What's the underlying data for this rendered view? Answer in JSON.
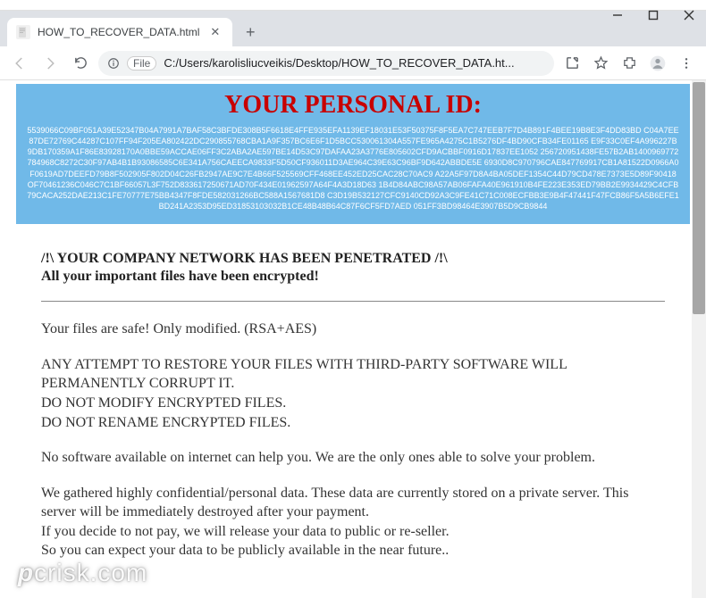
{
  "window": {
    "tab_title": "HOW_TO_RECOVER_DATA.html",
    "file_label": "File",
    "url": "C:/Users/karolisliucveikis/Desktop/HOW_TO_RECOVER_DATA.ht..."
  },
  "ransom": {
    "id_heading": "YOUR PERSONAL ID:",
    "id_l1": "5539066C09BF051A39E52347B04A7991A7BAF58C3BFDE308B5F6618E4FFE935EFA1139EF18031E53F50375F8F5EA7C747EEB7F7D4B891F4BEE19B8E3F4DD83BD",
    "id_l2": "C04A7EE87DE72769C44287C107FF94F205EA802422DC290855768CBA1A9F357BC6E6F1D5BCC530061304A557FE965A4275C1B5276DF4BD90CFB34FE01165",
    "id_l3": "E9F33C0EF4A996227B9DB170359A1F86E83928170A0BBE59ACCAE06FF3C2ABA2AE597BE14D53C97DAFAA23A3776E805602CFD9ACBBF0916D17837EE1052",
    "id_l4": "256720951438FE57B2AB1400969772784968C8272C30F97AB4B1B93086585C6E341A756CAEECA9833F5D50CF936011D3AE964C39E63C96BF9D642ABBDE5E",
    "id_l5": "6930D8C970796CAE847769917CB1A81522D0966A0F0619AD7DEEFD79B8F502905F802D04C26FB2947AE9C7E4B66F525569CFF468EE452ED25CAC28C70AC9",
    "id_l6": "A22A5F97D8A4BA05DEF1354C44D79CD478E7373E5D89F90418OF70461236C046C7C1BF66057L3F752D833617250671AD70F434E01962597A64F4A3D18D63",
    "id_l7": "1B4D84ABC98A57AB06FAFA40E961910B4FE223E353ED79BB2E9934429C4CFB79CACA252DAE213C1FE70777E75BB4347F8FDE582031266BC588A1567681D8",
    "id_l8": "C3D19B532127CFC9140CD92A3C9FE41C71C008ECFBB3E9B4F47441F47FCB86F5A5B6EFE1BD241A2353D95ED31853103032B1CE48B48B64C87F6CF5FD7AED",
    "id_l9": "051FF3BD98464E3907B5D9CB9844",
    "headline": "/!\\ YOUR COMPANY NETWORK HAS BEEN PENETRATED /!\\",
    "subhead": "All your important files have been encrypted!",
    "p_safe": "Your files are safe! Only modified. (RSA+AES)",
    "p_warn1": "ANY ATTEMPT TO RESTORE YOUR FILES WITH THIRD-PARTY SOFTWARE WILL PERMANENTLY CORRUPT IT.",
    "p_warn2": "DO NOT MODIFY ENCRYPTED FILES.",
    "p_warn3": "DO NOT RENAME ENCRYPTED FILES.",
    "p_help": "No software available on internet can help you. We are the only ones able to solve your problem.",
    "p_data1": "We gathered highly confidential/personal data. These data are currently stored on a private server. This server will be immediately destroyed after your payment.",
    "p_data2": "If you decide to not pay, we will release your data to public or re-seller.",
    "p_data3": "So you can expect your data to be publicly available in the near future.."
  },
  "watermark": {
    "text": "pcrisk.com"
  }
}
